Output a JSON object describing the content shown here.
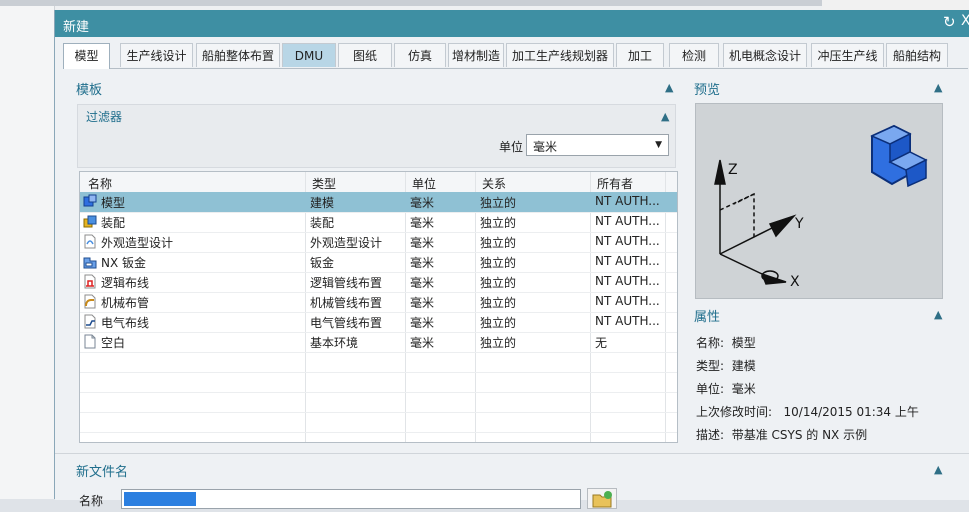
{
  "window": {
    "title": "新建",
    "refresh_icon": "refresh-icon",
    "close_glyph": "X"
  },
  "tabs": [
    {
      "label": "模型",
      "active": true
    },
    {
      "label": "生产线设计"
    },
    {
      "label": "船舶整体布置"
    },
    {
      "label": "DMU"
    },
    {
      "label": "图纸"
    },
    {
      "label": "仿真"
    },
    {
      "label": "增材制造"
    },
    {
      "label": "加工生产线规划器"
    },
    {
      "label": "加工"
    },
    {
      "label": "检测"
    },
    {
      "label": "机电概念设计"
    },
    {
      "label": "冲压生产线"
    },
    {
      "label": "船舶结构"
    }
  ],
  "templates": {
    "title": "模板",
    "filter_title": "过滤器",
    "unit_label": "单位",
    "unit_value": "毫米",
    "columns": [
      "名称",
      "类型",
      "单位",
      "关系",
      "所有者"
    ],
    "rows": [
      {
        "name": "模型",
        "type": "建模",
        "unit": "毫米",
        "relation": "独立的",
        "owner": "NT AUTH...",
        "selected": true,
        "icon": "model-template-icon"
      },
      {
        "name": "装配",
        "type": "装配",
        "unit": "毫米",
        "relation": "独立的",
        "owner": "NT AUTH...",
        "icon": "assembly-template-icon"
      },
      {
        "name": "外观造型设计",
        "type": "外观造型设计",
        "unit": "毫米",
        "relation": "独立的",
        "owner": "NT AUTH...",
        "icon": "shape-studio-template-icon"
      },
      {
        "name": "NX 钣金",
        "type": "钣金",
        "unit": "毫米",
        "relation": "独立的",
        "owner": "NT AUTH...",
        "icon": "sheet-metal-template-icon"
      },
      {
        "name": "逻辑布线",
        "type": "逻辑管线布置",
        "unit": "毫米",
        "relation": "独立的",
        "owner": "NT AUTH...",
        "icon": "logical-routing-template-icon"
      },
      {
        "name": "机械布管",
        "type": "机械管线布置",
        "unit": "毫米",
        "relation": "独立的",
        "owner": "NT AUTH...",
        "icon": "mechanical-routing-template-icon"
      },
      {
        "name": "电气布线",
        "type": "电气管线布置",
        "unit": "毫米",
        "relation": "独立的",
        "owner": "NT AUTH...",
        "icon": "electrical-routing-template-icon"
      },
      {
        "name": "空白",
        "type": "基本环境",
        "unit": "毫米",
        "relation": "独立的",
        "owner": "无",
        "icon": "blank-template-icon"
      }
    ]
  },
  "preview": {
    "title": "预览",
    "axis_labels": {
      "z": "Z",
      "y": "Y",
      "x": "X"
    }
  },
  "properties": {
    "title": "属性",
    "name_label": "名称:",
    "name_value": "模型",
    "type_label": "类型:",
    "type_value": "建模",
    "unit_label": "单位:",
    "unit_value": "毫米",
    "modified_label": "上次修改时间:",
    "modified_value": "10/14/2015 01:34 上午",
    "desc_label": "描述:",
    "desc_value": "带基准 CSYS 的 NX 示例"
  },
  "new_file": {
    "title": "新文件名",
    "name_label": "名称"
  },
  "colors": {
    "titlebar": "#3e8fa3",
    "selection": "#8fc1d4",
    "accent_text": "#1f6e8c",
    "cube": "#2f6fe0"
  }
}
